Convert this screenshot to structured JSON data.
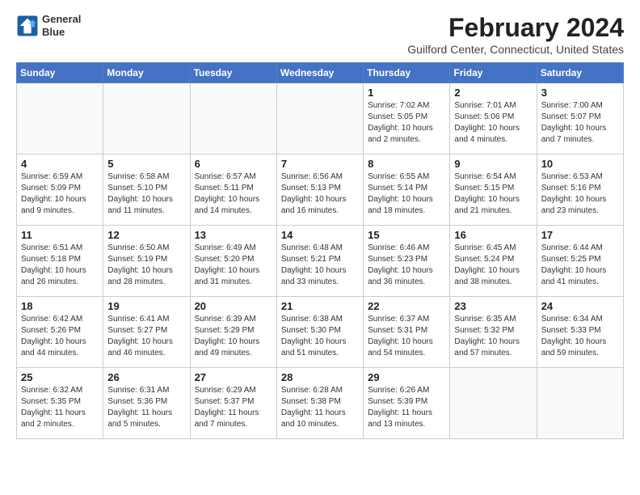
{
  "header": {
    "logo_line1": "General",
    "logo_line2": "Blue",
    "title": "February 2024",
    "subtitle": "Guilford Center, Connecticut, United States"
  },
  "calendar": {
    "weekdays": [
      "Sunday",
      "Monday",
      "Tuesday",
      "Wednesday",
      "Thursday",
      "Friday",
      "Saturday"
    ],
    "weeks": [
      [
        {
          "day": "",
          "detail": ""
        },
        {
          "day": "",
          "detail": ""
        },
        {
          "day": "",
          "detail": ""
        },
        {
          "day": "",
          "detail": ""
        },
        {
          "day": "1",
          "detail": "Sunrise: 7:02 AM\nSunset: 5:05 PM\nDaylight: 10 hours\nand 2 minutes."
        },
        {
          "day": "2",
          "detail": "Sunrise: 7:01 AM\nSunset: 5:06 PM\nDaylight: 10 hours\nand 4 minutes."
        },
        {
          "day": "3",
          "detail": "Sunrise: 7:00 AM\nSunset: 5:07 PM\nDaylight: 10 hours\nand 7 minutes."
        }
      ],
      [
        {
          "day": "4",
          "detail": "Sunrise: 6:59 AM\nSunset: 5:09 PM\nDaylight: 10 hours\nand 9 minutes."
        },
        {
          "day": "5",
          "detail": "Sunrise: 6:58 AM\nSunset: 5:10 PM\nDaylight: 10 hours\nand 11 minutes."
        },
        {
          "day": "6",
          "detail": "Sunrise: 6:57 AM\nSunset: 5:11 PM\nDaylight: 10 hours\nand 14 minutes."
        },
        {
          "day": "7",
          "detail": "Sunrise: 6:56 AM\nSunset: 5:13 PM\nDaylight: 10 hours\nand 16 minutes."
        },
        {
          "day": "8",
          "detail": "Sunrise: 6:55 AM\nSunset: 5:14 PM\nDaylight: 10 hours\nand 18 minutes."
        },
        {
          "day": "9",
          "detail": "Sunrise: 6:54 AM\nSunset: 5:15 PM\nDaylight: 10 hours\nand 21 minutes."
        },
        {
          "day": "10",
          "detail": "Sunrise: 6:53 AM\nSunset: 5:16 PM\nDaylight: 10 hours\nand 23 minutes."
        }
      ],
      [
        {
          "day": "11",
          "detail": "Sunrise: 6:51 AM\nSunset: 5:18 PM\nDaylight: 10 hours\nand 26 minutes."
        },
        {
          "day": "12",
          "detail": "Sunrise: 6:50 AM\nSunset: 5:19 PM\nDaylight: 10 hours\nand 28 minutes."
        },
        {
          "day": "13",
          "detail": "Sunrise: 6:49 AM\nSunset: 5:20 PM\nDaylight: 10 hours\nand 31 minutes."
        },
        {
          "day": "14",
          "detail": "Sunrise: 6:48 AM\nSunset: 5:21 PM\nDaylight: 10 hours\nand 33 minutes."
        },
        {
          "day": "15",
          "detail": "Sunrise: 6:46 AM\nSunset: 5:23 PM\nDaylight: 10 hours\nand 36 minutes."
        },
        {
          "day": "16",
          "detail": "Sunrise: 6:45 AM\nSunset: 5:24 PM\nDaylight: 10 hours\nand 38 minutes."
        },
        {
          "day": "17",
          "detail": "Sunrise: 6:44 AM\nSunset: 5:25 PM\nDaylight: 10 hours\nand 41 minutes."
        }
      ],
      [
        {
          "day": "18",
          "detail": "Sunrise: 6:42 AM\nSunset: 5:26 PM\nDaylight: 10 hours\nand 44 minutes."
        },
        {
          "day": "19",
          "detail": "Sunrise: 6:41 AM\nSunset: 5:27 PM\nDaylight: 10 hours\nand 46 minutes."
        },
        {
          "day": "20",
          "detail": "Sunrise: 6:39 AM\nSunset: 5:29 PM\nDaylight: 10 hours\nand 49 minutes."
        },
        {
          "day": "21",
          "detail": "Sunrise: 6:38 AM\nSunset: 5:30 PM\nDaylight: 10 hours\nand 51 minutes."
        },
        {
          "day": "22",
          "detail": "Sunrise: 6:37 AM\nSunset: 5:31 PM\nDaylight: 10 hours\nand 54 minutes."
        },
        {
          "day": "23",
          "detail": "Sunrise: 6:35 AM\nSunset: 5:32 PM\nDaylight: 10 hours\nand 57 minutes."
        },
        {
          "day": "24",
          "detail": "Sunrise: 6:34 AM\nSunset: 5:33 PM\nDaylight: 10 hours\nand 59 minutes."
        }
      ],
      [
        {
          "day": "25",
          "detail": "Sunrise: 6:32 AM\nSunset: 5:35 PM\nDaylight: 11 hours\nand 2 minutes."
        },
        {
          "day": "26",
          "detail": "Sunrise: 6:31 AM\nSunset: 5:36 PM\nDaylight: 11 hours\nand 5 minutes."
        },
        {
          "day": "27",
          "detail": "Sunrise: 6:29 AM\nSunset: 5:37 PM\nDaylight: 11 hours\nand 7 minutes."
        },
        {
          "day": "28",
          "detail": "Sunrise: 6:28 AM\nSunset: 5:38 PM\nDaylight: 11 hours\nand 10 minutes."
        },
        {
          "day": "29",
          "detail": "Sunrise: 6:26 AM\nSunset: 5:39 PM\nDaylight: 11 hours\nand 13 minutes."
        },
        {
          "day": "",
          "detail": ""
        },
        {
          "day": "",
          "detail": ""
        }
      ]
    ]
  }
}
